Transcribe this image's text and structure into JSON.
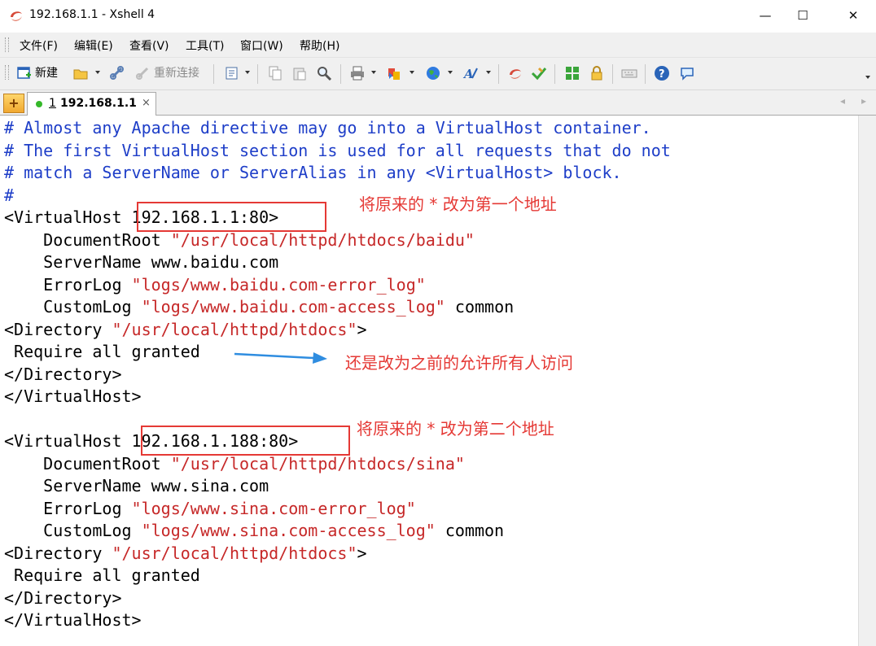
{
  "window": {
    "title": "192.168.1.1 - Xshell 4",
    "minimize_glyph": "—",
    "maximize_glyph": "☐",
    "close_glyph": "✕"
  },
  "menu": [
    "文件(F)",
    "编辑(E)",
    "查看(V)",
    "工具(T)",
    "窗口(W)",
    "帮助(H)"
  ],
  "toolbar": {
    "new_label": "新建",
    "reconnect_label": "重新连接"
  },
  "tabs": {
    "add_glyph": "+",
    "active": {
      "index": "1",
      "label": "192.168.1.1",
      "close": "×"
    },
    "nav_left": "◂",
    "nav_right": "▸"
  },
  "terminal": {
    "lines": [
      [
        {
          "t": "# Almost any Apache directive may go into a VirtualHost container.",
          "k": "c"
        }
      ],
      [
        {
          "t": "# The first VirtualHost section is used for all requests that do not",
          "k": "c"
        }
      ],
      [
        {
          "t": "# match a ServerName or ServerAlias in any <VirtualHost> block.",
          "k": "c"
        }
      ],
      [
        {
          "t": "#",
          "k": "c"
        }
      ],
      [
        {
          "t": "<VirtualHost 192.168.1.1:80>",
          "k": ""
        }
      ],
      [
        {
          "t": "    DocumentRoot ",
          "k": ""
        },
        {
          "t": "\"/usr/local/httpd/htdocs/baidu\"",
          "k": "s"
        }
      ],
      [
        {
          "t": "    ServerName www.baidu.com",
          "k": ""
        }
      ],
      [
        {
          "t": "    ErrorLog ",
          "k": ""
        },
        {
          "t": "\"logs/www.baidu.com-error_log\"",
          "k": "s"
        }
      ],
      [
        {
          "t": "    CustomLog ",
          "k": ""
        },
        {
          "t": "\"logs/www.baidu.com-access_log\"",
          "k": "s"
        },
        {
          "t": " common",
          "k": ""
        }
      ],
      [
        {
          "t": "<Directory ",
          "k": ""
        },
        {
          "t": "\"/usr/local/httpd/htdocs\"",
          "k": "s"
        },
        {
          "t": ">",
          "k": ""
        }
      ],
      [
        {
          "t": " Require all granted",
          "k": ""
        }
      ],
      [
        {
          "t": "</Directory>",
          "k": ""
        }
      ],
      [
        {
          "t": "</VirtualHost>",
          "k": ""
        }
      ],
      [
        {
          "t": "",
          "k": ""
        }
      ],
      [
        {
          "t": "<VirtualHost 192.168.1.188:80>",
          "k": ""
        }
      ],
      [
        {
          "t": "    DocumentRoot ",
          "k": ""
        },
        {
          "t": "\"/usr/local/httpd/htdocs/sina\"",
          "k": "s"
        }
      ],
      [
        {
          "t": "    ServerName www.sina.com",
          "k": ""
        }
      ],
      [
        {
          "t": "    ErrorLog ",
          "k": ""
        },
        {
          "t": "\"logs/www.sina.com-error_log\"",
          "k": "s"
        }
      ],
      [
        {
          "t": "    CustomLog ",
          "k": ""
        },
        {
          "t": "\"logs/www.sina.com-access_log\"",
          "k": "s"
        },
        {
          "t": " common",
          "k": ""
        }
      ],
      [
        {
          "t": "<Directory ",
          "k": ""
        },
        {
          "t": "\"/usr/local/httpd/htdocs\"",
          "k": "s"
        },
        {
          "t": ">",
          "k": ""
        }
      ],
      [
        {
          "t": " Require all granted",
          "k": ""
        }
      ],
      [
        {
          "t": "</Directory>",
          "k": ""
        }
      ],
      [
        {
          "t": "</VirtualHost>",
          "k": ""
        }
      ]
    ]
  },
  "annotations": {
    "first_address_note": "将原来的 * 改为第一个地址",
    "require_note": "还是改为之前的允许所有人访问",
    "second_address_note": "将原来的 * 改为第二个地址"
  },
  "colors": {
    "comment": "#1e3ec8",
    "string": "#c62828",
    "annotation": "#e53935",
    "arrow": "#2f8de0"
  }
}
